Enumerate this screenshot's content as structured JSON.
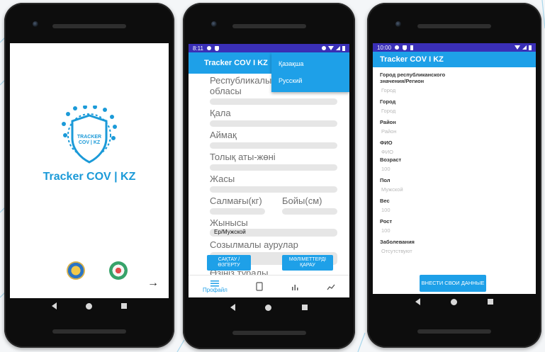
{
  "phone1": {
    "app_title": "Tracker COV | KZ",
    "shield_text_top": "TRACKER",
    "shield_text_bottom": "COV | KZ",
    "next_arrow": "→"
  },
  "phone2": {
    "status_time": "8:11",
    "app_title": "Tracker COV I KZ",
    "menu_items": [
      "Қазақша",
      "Русский"
    ],
    "fields": {
      "region": "Республикалы\nобласы",
      "city": "Қала",
      "district": "Аймақ",
      "fullname": "Толық аты-жөні",
      "age": "Жасы",
      "weight": "Салмағы(кг)",
      "height": "Бойы(см)",
      "gender": "Жынысы",
      "gender_value": "Ер/Мужской",
      "chronic": "Созылмалы аурулар",
      "about": "Өзіңіз туралы"
    },
    "buttons": {
      "save": "САҚТАУ / ӨЗГЕРТУ",
      "view": "МӘЛІМЕТТЕРДІ ҚАРАУ"
    },
    "tabs": {
      "profile": "Профайл"
    }
  },
  "phone3": {
    "status_time": "10:00",
    "app_title": "Tracker COV I KZ",
    "fields": [
      {
        "label": "Город республиканского\nзначения/Регион",
        "placeholder": "Город"
      },
      {
        "label": "Город",
        "placeholder": "Город"
      },
      {
        "label": "Район",
        "placeholder": "Район"
      },
      {
        "label": "ФИО",
        "placeholder": "ФИО"
      },
      {
        "label": "Возраст",
        "placeholder": "100"
      },
      {
        "label": "Пол",
        "placeholder": "Мужской"
      },
      {
        "label": "Вес",
        "placeholder": "100"
      },
      {
        "label": "Рост",
        "placeholder": "100"
      },
      {
        "label": "Заболевания",
        "placeholder": "Отсутствуют"
      }
    ],
    "submit_button": "ВНЕСТИ СВОИ ДАННЫЕ"
  },
  "colors": {
    "accent": "#1ea0e8",
    "status_bar": "#3a2fb7",
    "title_blue": "#1b9ad8"
  }
}
